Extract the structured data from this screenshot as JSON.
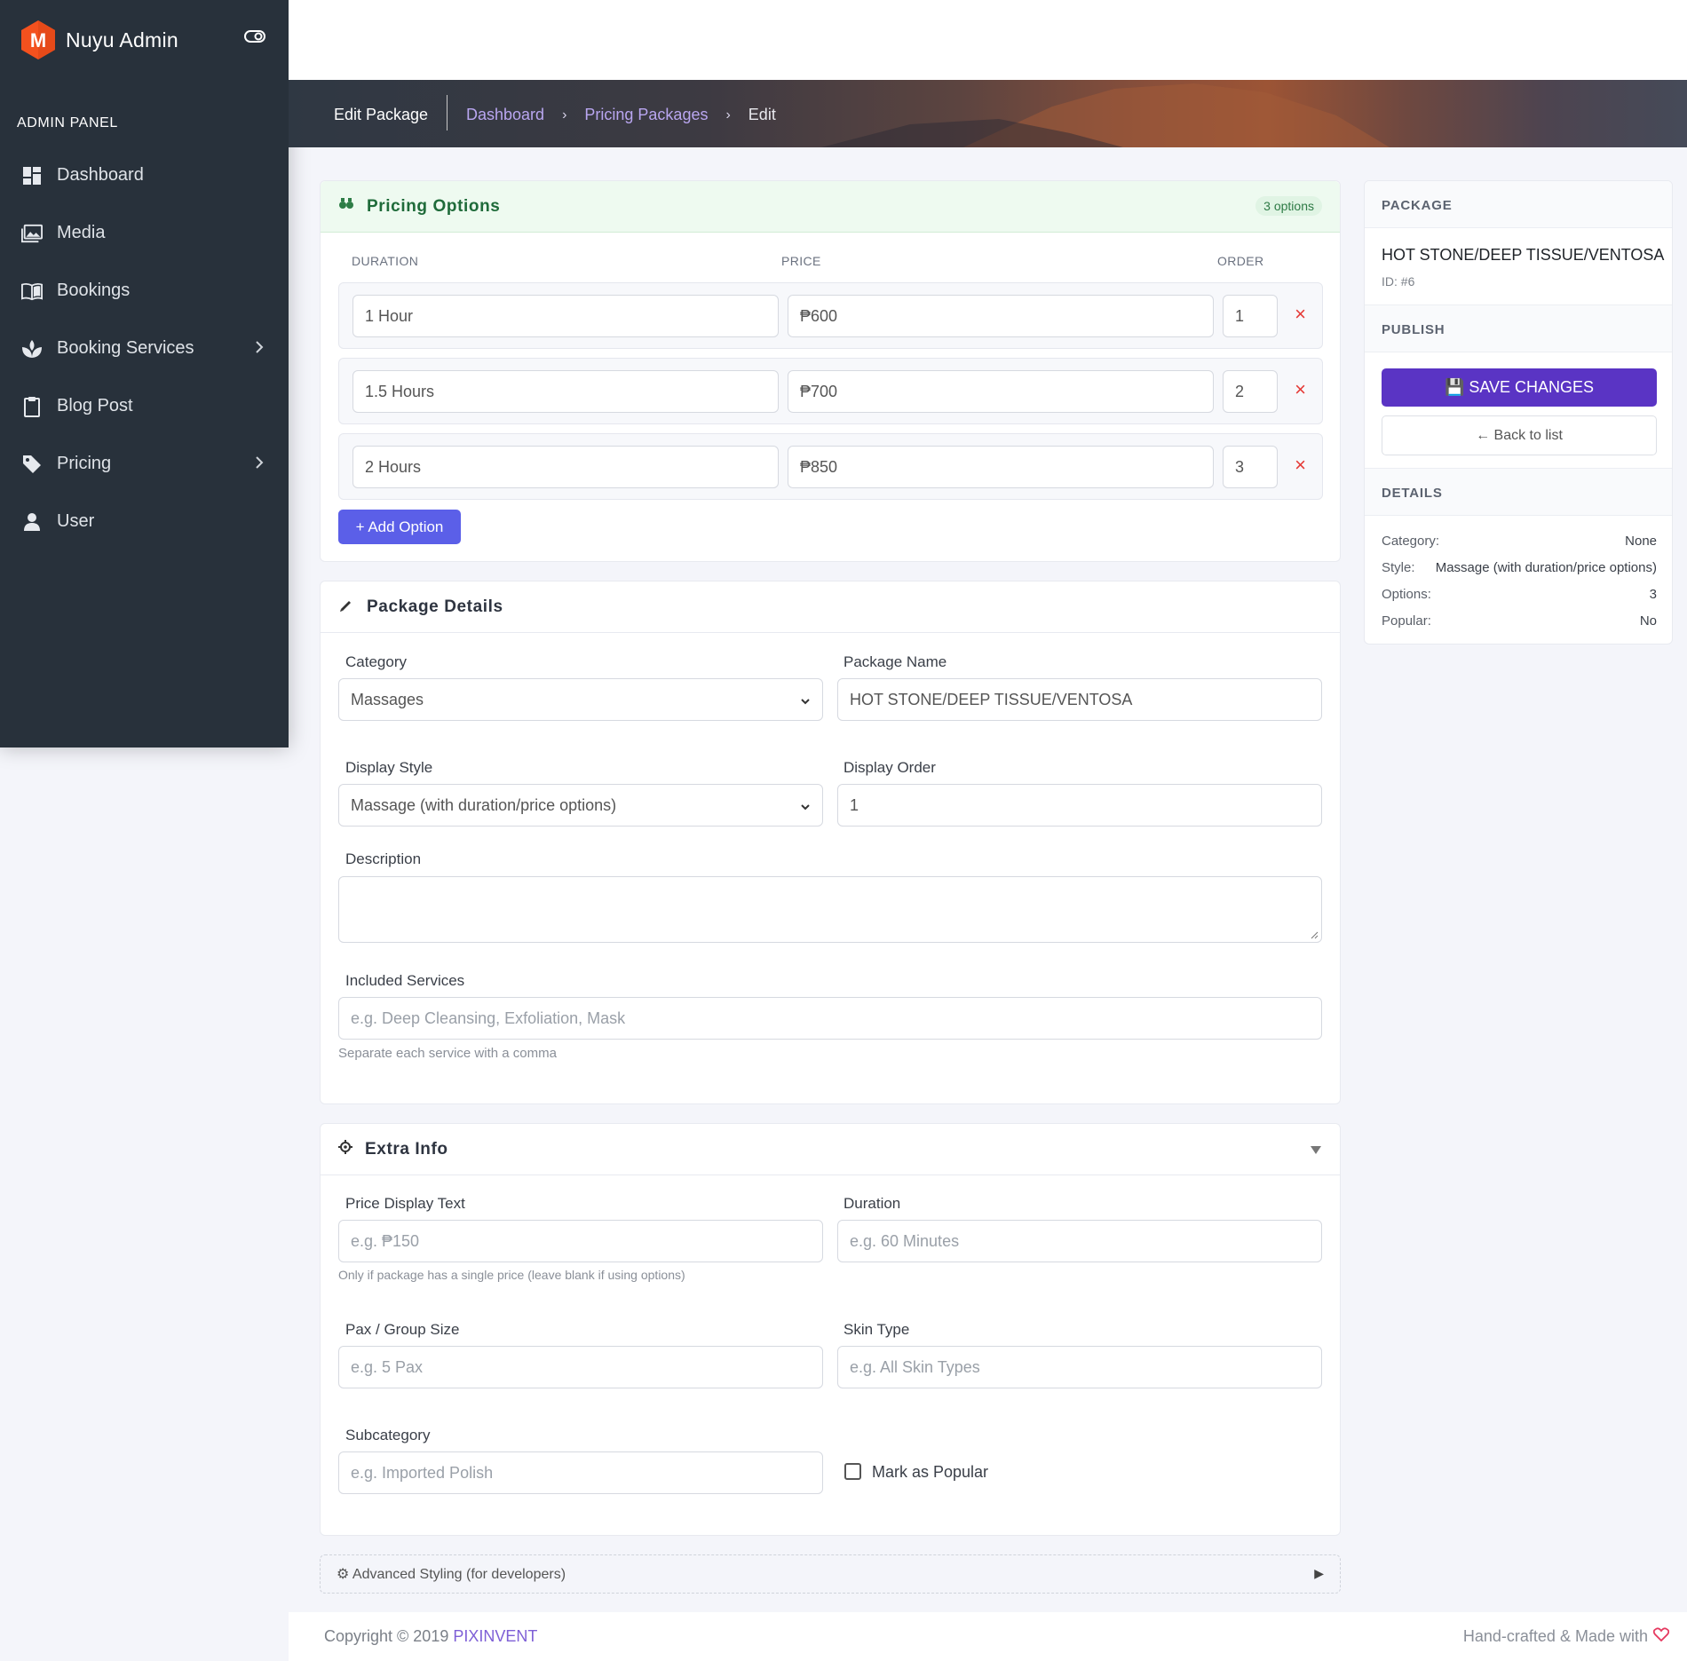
{
  "app": {
    "name": "Nuyu Admin",
    "logo_letter": "M",
    "panel_label": "ADMIN PANEL"
  },
  "sidebar": {
    "items": [
      {
        "label": "Dashboard",
        "icon": "dashboard-icon"
      },
      {
        "label": "Media",
        "icon": "media-icon"
      },
      {
        "label": "Bookings",
        "icon": "book-icon"
      },
      {
        "label": "Booking Services",
        "icon": "spa-icon",
        "has_submenu": true
      },
      {
        "label": "Blog Post",
        "icon": "clipboard-icon"
      },
      {
        "label": "Pricing",
        "icon": "tag-icon",
        "has_submenu": true
      },
      {
        "label": "User",
        "icon": "user-icon"
      }
    ]
  },
  "header": {
    "page_title": "Edit Package",
    "breadcrumbs": [
      "Dashboard",
      "Pricing Packages",
      "Edit"
    ]
  },
  "pricing_options": {
    "title": "Pricing Options",
    "badge": "3 options",
    "columns": [
      "DURATION",
      "PRICE",
      "ORDER"
    ],
    "rows": [
      {
        "duration": "1 Hour",
        "price": "₱600",
        "order": "1"
      },
      {
        "duration": "1.5 Hours",
        "price": "₱700",
        "order": "2"
      },
      {
        "duration": "2 Hours",
        "price": "₱850",
        "order": "3"
      }
    ],
    "remove_glyph": "×",
    "add_button": "+ Add Option"
  },
  "package_details": {
    "title": "Package Details",
    "category_label": "Category",
    "category_value": "Massages",
    "name_label": "Package Name",
    "name_value": "HOT STONE/DEEP TISSUE/VENTOSA",
    "display_style_label": "Display Style",
    "display_style_value": "Massage (with duration/price options)",
    "display_order_label": "Display Order",
    "display_order_value": "1",
    "description_label": "Description",
    "description_value": "",
    "included_label": "Included Services",
    "included_placeholder": "e.g. Deep Cleansing, Exfoliation, Mask",
    "included_help": "Separate each service with a comma"
  },
  "extra_info": {
    "title": "Extra Info",
    "price_text_label": "Price Display Text",
    "price_text_placeholder": "e.g. ₱150",
    "price_text_help": "Only if package has a single price (leave blank if using options)",
    "duration_label": "Duration",
    "duration_placeholder": "e.g. 60 Minutes",
    "pax_label": "Pax / Group Size",
    "pax_placeholder": "e.g. 5 Pax",
    "skin_label": "Skin Type",
    "skin_placeholder": "e.g. All Skin Types",
    "subcategory_label": "Subcategory",
    "subcategory_placeholder": "e.g. Imported Polish",
    "popular_label": "Mark as Popular",
    "popular_checked": false
  },
  "advanced": {
    "label": "⚙ Advanced Styling (for developers)"
  },
  "side_panel": {
    "package_heading": "PACKAGE",
    "package_name": "HOT STONE/DEEP TISSUE/VENTOSA",
    "package_id": "ID: #6",
    "publish_heading": "PUBLISH",
    "save_label": "💾 SAVE CHANGES",
    "back_label": "← Back to list",
    "details_heading": "DETAILS",
    "details": [
      {
        "k": "Category:",
        "v": "None"
      },
      {
        "k": "Style:",
        "v": "Massage (with duration/price options)"
      },
      {
        "k": "Options:",
        "v": "3"
      },
      {
        "k": "Popular:",
        "v": "No"
      }
    ]
  },
  "footer": {
    "copyright_prefix": "Copyright © 2019 ",
    "copyright_brand": "PIXINVENT",
    "made_with": "Hand-crafted & Made with"
  },
  "colors": {
    "sidebar_bg": "#28313b",
    "accent_purple": "#5a34c4",
    "add_button": "#5b5fe8",
    "remove_red": "#e53935",
    "pricing_header_bg": "#eefaf0"
  }
}
